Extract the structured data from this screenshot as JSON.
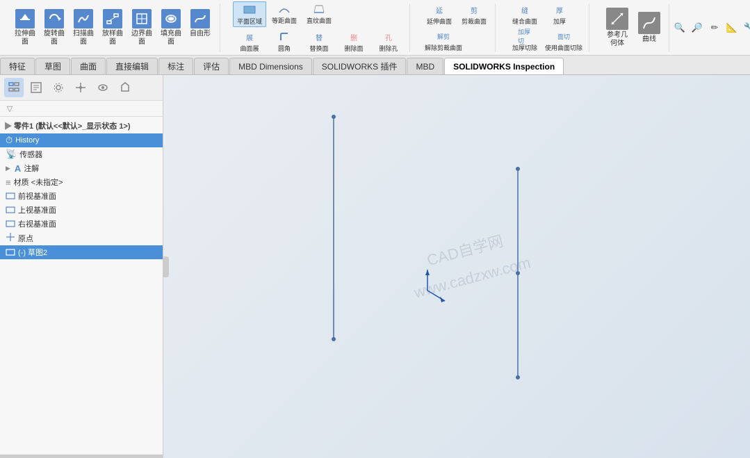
{
  "toolbar": {
    "groups": [
      {
        "buttons": [
          {
            "id": "pull-surface",
            "label": "拉伸曲\n面",
            "icon": "↑",
            "color": "#5588cc"
          },
          {
            "id": "rotate-surface",
            "label": "旋转曲\n面",
            "icon": "↻",
            "color": "#5588cc"
          },
          {
            "id": "scan-surface",
            "label": "扫描曲\n面",
            "icon": "⟳",
            "color": "#5588cc"
          },
          {
            "id": "放样曲面",
            "label": "放样曲\n面",
            "icon": "◈",
            "color": "#5588cc"
          },
          {
            "id": "边界曲面",
            "label": "边界曲\n面",
            "icon": "⊡",
            "color": "#5588cc"
          },
          {
            "id": "填充曲面",
            "label": "填充曲\n面",
            "icon": "▦",
            "color": "#5588cc"
          },
          {
            "id": "自由形",
            "label": "自由形",
            "icon": "〜",
            "color": "#5588cc"
          }
        ]
      },
      {
        "buttons_top": [
          {
            "id": "平面区域",
            "label": "平面区域",
            "highlighted": true
          },
          {
            "id": "等距曲面",
            "label": "等距曲面"
          },
          {
            "id": "直纹曲面",
            "label": "直纹曲面"
          }
        ],
        "buttons_bottom": [
          {
            "id": "曲面展开",
            "label": "曲面展"
          },
          {
            "id": "圆角",
            "label": "圆角"
          },
          {
            "id": "替换面",
            "label": "替换面"
          },
          {
            "id": "删除面",
            "label": "删除面"
          },
          {
            "id": "删除孔",
            "label": "删除孔"
          }
        ]
      },
      {
        "buttons_top": [
          {
            "id": "延伸曲面",
            "label": "延伸曲面"
          },
          {
            "id": "剪裁曲面",
            "label": "剪裁曲面"
          },
          {
            "id": "解除剪裁曲面",
            "label": "解除剪裁曲面"
          }
        ],
        "buttons_bottom": []
      },
      {
        "buttons_top": [
          {
            "id": "缝合曲面",
            "label": "缝合曲面"
          },
          {
            "id": "加厚",
            "label": "加厚"
          },
          {
            "id": "加厚切除",
            "label": "加厚切除"
          },
          {
            "id": "使用曲面切除",
            "label": "使用曲面切除"
          }
        ]
      },
      {
        "special": [
          {
            "id": "参考几何体",
            "label": "参考几\n何体"
          },
          {
            "id": "曲线",
            "label": "曲线"
          }
        ]
      }
    ]
  },
  "tabs": [
    {
      "id": "feature",
      "label": "特征",
      "active": false
    },
    {
      "id": "sketch",
      "label": "草图",
      "active": false
    },
    {
      "id": "surface",
      "label": "曲面",
      "active": false
    },
    {
      "id": "direct-edit",
      "label": "直接编辑",
      "active": false
    },
    {
      "id": "dimension",
      "label": "标注",
      "active": false
    },
    {
      "id": "evaluate",
      "label": "评估",
      "active": false
    },
    {
      "id": "mbd-dimensions",
      "label": "MBD Dimensions",
      "active": false
    },
    {
      "id": "solidworks-plugin",
      "label": "SOLIDWORKS 插件",
      "active": false
    },
    {
      "id": "mbd",
      "label": "MBD",
      "active": false
    },
    {
      "id": "solidworks-inspection",
      "label": "SOLIDWORKS Inspection",
      "active": true
    }
  ],
  "sidebar": {
    "icons": [
      {
        "id": "feature-tree",
        "icon": "⊞",
        "tooltip": "特征树"
      },
      {
        "id": "property",
        "icon": "📋",
        "tooltip": "属性"
      },
      {
        "id": "config",
        "icon": "⚙",
        "tooltip": "配置"
      },
      {
        "id": "origin",
        "icon": "⊕",
        "tooltip": "原点"
      },
      {
        "id": "display",
        "icon": "◉",
        "tooltip": "显示"
      },
      {
        "id": "sensor",
        "icon": "📡",
        "tooltip": "传感器"
      }
    ],
    "root_label": "零件1 (默认<<默认>_显示状态 1>)",
    "items": [
      {
        "id": "history",
        "label": "History",
        "icon": "⏱",
        "indent": 1,
        "selected": true,
        "chevron": false
      },
      {
        "id": "sensor",
        "label": "传感器",
        "icon": "📡",
        "indent": 1,
        "chevron": false
      },
      {
        "id": "annotation",
        "label": "注解",
        "icon": "A",
        "indent": 1,
        "chevron": true
      },
      {
        "id": "material",
        "label": "材质 <未指定>",
        "icon": "≡",
        "indent": 1,
        "chevron": false
      },
      {
        "id": "front-plane",
        "label": "前视基准面",
        "icon": "▭",
        "indent": 1,
        "chevron": false
      },
      {
        "id": "top-plane",
        "label": "上视基准面",
        "icon": "▭",
        "indent": 1,
        "chevron": false
      },
      {
        "id": "right-plane",
        "label": "右视基准面",
        "icon": "▭",
        "indent": 1,
        "chevron": false
      },
      {
        "id": "origin-item",
        "label": "原点",
        "icon": "⊕",
        "indent": 1,
        "chevron": false
      },
      {
        "id": "sketch2",
        "label": "(-) 草图2",
        "icon": "▱",
        "indent": 1,
        "chevron": false
      }
    ]
  },
  "canvas": {
    "watermark_lines": [
      "CAD自学网",
      "www.cadzxw.com"
    ]
  },
  "top_right_icons": [
    "🔍",
    "🔎",
    "✏",
    "📐",
    "🔧",
    "💾",
    "⬜",
    "👁"
  ]
}
